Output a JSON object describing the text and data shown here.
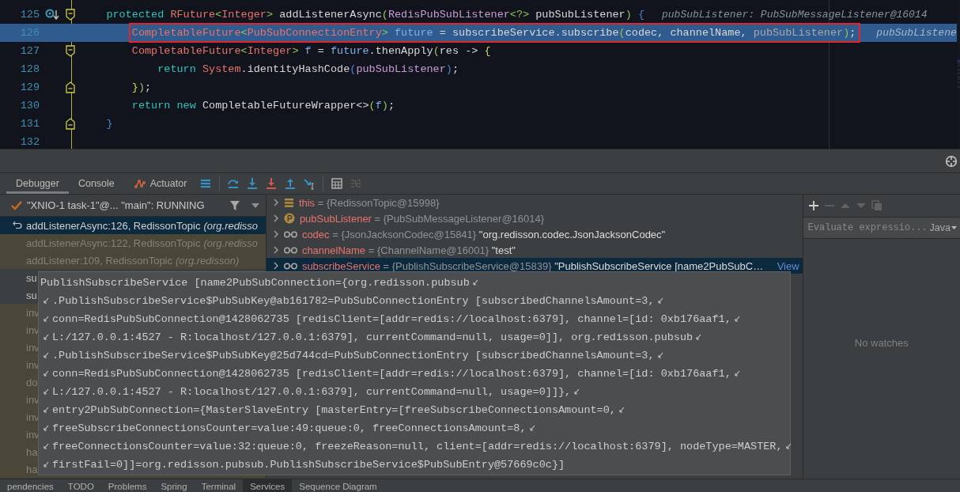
{
  "editor": {
    "lines": [
      {
        "number": "125",
        "method_breakpoint": true,
        "fold_open": true,
        "fold_close": false,
        "selected": false,
        "tokens": [
          {
            "kind": "kw",
            "text": "    protected "
          },
          {
            "kind": "type",
            "text": "RFuture"
          },
          {
            "kind": "angle",
            "text": "<"
          },
          {
            "kind": "type",
            "text": "Integer"
          },
          {
            "kind": "angle",
            "text": ">"
          },
          {
            "kind": "plain",
            "text": " addListenerAsync"
          },
          {
            "kind": "paren",
            "text": "("
          },
          {
            "kind": "iface",
            "text": "RedisPubSubListener"
          },
          {
            "kind": "angle",
            "text": "<?>"
          },
          {
            "kind": "plain",
            "text": " pubSubListener"
          },
          {
            "kind": "paren",
            "text": ")"
          },
          {
            "kind": "brace",
            "text": " {"
          }
        ],
        "hint": "pubSubListener: PubSubMessageListener@16014"
      },
      {
        "number": "126",
        "fold_open": false,
        "fold_close": false,
        "selected": true,
        "boxed": true,
        "tokens": [
          {
            "kind": "type",
            "text": "        CompletableFuture"
          },
          {
            "kind": "angle",
            "text": "<"
          },
          {
            "kind": "type",
            "text": "PubSubConnectionEntry"
          },
          {
            "kind": "angle",
            "text": ">"
          },
          {
            "kind": "local",
            "text": " future"
          },
          {
            "kind": "plain",
            "text": " = subscribeService.subscribe"
          },
          {
            "kind": "paren",
            "text": "("
          },
          {
            "kind": "plain",
            "text": "codec, channelName, "
          },
          {
            "kind": "dim",
            "text": "pubSubListener"
          },
          {
            "kind": "paren",
            "text": ")"
          },
          {
            "kind": "plain",
            "text": ";"
          }
        ],
        "hint": "pubSubListene"
      },
      {
        "number": "127",
        "fold_open": true,
        "fold_close": false,
        "selected": false,
        "tokens": [
          {
            "kind": "type",
            "text": "        CompletableFuture"
          },
          {
            "kind": "angle",
            "text": "<"
          },
          {
            "kind": "type",
            "text": "Integer"
          },
          {
            "kind": "angle",
            "text": ">"
          },
          {
            "kind": "local",
            "text": " f"
          },
          {
            "kind": "plain",
            "text": " = "
          },
          {
            "kind": "local",
            "text": "future"
          },
          {
            "kind": "plain",
            "text": ".thenApply"
          },
          {
            "kind": "paren",
            "text": "("
          },
          {
            "kind": "plain",
            "text": "res -> "
          },
          {
            "kind": "lambda",
            "text": "{"
          }
        ]
      },
      {
        "number": "128",
        "fold_open": false,
        "fold_close": false,
        "selected": false,
        "tokens": [
          {
            "kind": "kw",
            "text": "            return "
          },
          {
            "kind": "type",
            "text": "System"
          },
          {
            "kind": "plain",
            "text": ".identityHashCode"
          },
          {
            "kind": "brace",
            "text": "("
          },
          {
            "kind": "iface",
            "text": "pubSubListener"
          },
          {
            "kind": "brace",
            "text": ")"
          },
          {
            "kind": "plain",
            "text": ";"
          }
        ]
      },
      {
        "number": "129",
        "fold_open": false,
        "fold_close": true,
        "selected": false,
        "tokens": [
          {
            "kind": "lambda",
            "text": "        }"
          },
          {
            "kind": "paren",
            "text": ")"
          },
          {
            "kind": "plain",
            "text": ";"
          }
        ]
      },
      {
        "number": "130",
        "fold_open": false,
        "fold_close": false,
        "selected": false,
        "tokens": [
          {
            "kind": "kw",
            "text": "        return new "
          },
          {
            "kind": "plain",
            "text": "CompletableFutureWrapper<>"
          },
          {
            "kind": "paren",
            "text": "("
          },
          {
            "kind": "local",
            "text": "f"
          },
          {
            "kind": "paren",
            "text": ")"
          },
          {
            "kind": "plain",
            "text": ";"
          }
        ]
      },
      {
        "number": "131",
        "fold_open": false,
        "fold_close": true,
        "selected": false,
        "tokens": [
          {
            "kind": "brace",
            "text": "    }"
          }
        ]
      },
      {
        "number": "132",
        "fold_open": false,
        "fold_close": false,
        "selected": false
      }
    ]
  },
  "debug_tabs": [
    {
      "label": "Debugger",
      "selected": true
    },
    {
      "label": "Console",
      "selected": false
    },
    {
      "label": "Actuator",
      "selected": false
    }
  ],
  "thread": {
    "label": "\"XNIO-1 task-1\"@... \"main\": RUNNING"
  },
  "frames": [
    {
      "location": "addListenerAsync:126, RedissonTopic",
      "package": "(org.redisso",
      "selected": true,
      "library": false
    },
    {
      "location": "addListenerAsync:122, RedissonTopic",
      "package": "(org.redisso",
      "selected": false,
      "library": true
    },
    {
      "location": "addListener:109, RedissonTopic",
      "package": "(org.redisson)",
      "selected": false,
      "library": true
    },
    {
      "location": "su",
      "selected": false,
      "library": false
    },
    {
      "location": "su",
      "selected": false,
      "library": false
    },
    {
      "location": "inv",
      "selected": false,
      "library": true
    },
    {
      "location": "inv",
      "selected": false,
      "library": true
    },
    {
      "location": "inv",
      "selected": false,
      "library": true
    },
    {
      "location": "inv",
      "selected": false,
      "library": true
    },
    {
      "location": "do",
      "selected": false,
      "library": true
    },
    {
      "location": "inv",
      "selected": false,
      "library": true
    },
    {
      "location": "inv",
      "selected": false,
      "library": true
    },
    {
      "location": "inv",
      "selected": false,
      "library": true
    },
    {
      "location": "ha",
      "selected": false,
      "library": true
    },
    {
      "location": "ha",
      "selected": false,
      "library": true
    }
  ],
  "variables": [
    {
      "kind": "field",
      "name": "this",
      "value": "= {RedissonTopic@15998}",
      "selected": false
    },
    {
      "kind": "param",
      "name": "pubSubListener",
      "value": "= {PubSubMessageListener@16014}",
      "selected": false
    },
    {
      "kind": "local",
      "name": "codec",
      "value": "= {JsonJacksonCodec@15841}",
      "string": "\"org.redisson.codec.JsonJacksonCodec\"",
      "selected": false
    },
    {
      "kind": "local",
      "name": "channelName",
      "value": "= {ChannelName@16001}",
      "string": "\"test\"",
      "selected": false
    },
    {
      "kind": "local",
      "name": "subscribeService",
      "value": "= {PublishSubscribeService@15839}",
      "string": "\"PublishSubscribeService [name2PubSubC…",
      "link": "View",
      "selected": true
    }
  ],
  "watches": {
    "placeholder": "Evaluate expressio...",
    "language": "Java",
    "empty_text": "No watches"
  },
  "tooltip": {
    "lines": [
      {
        "text": "PublishSubscribeService [name2PubSubConnection={org.redisson.pubsub",
        "continued": false,
        "wraps": true
      },
      {
        "text": ".PublishSubscribeService$PubSubKey@ab161782=PubSubConnectionEntry [subscribedChannelsAmount=3,",
        "continued": true,
        "wraps": true
      },
      {
        "text": "conn=RedisPubSubConnection@1428062735 [redisClient=[addr=redis://localhost:6379], channel=[id: 0xb176aaf1,",
        "continued": true,
        "wraps": true
      },
      {
        "text": "L:/127.0.0.1:4527 - R:localhost/127.0.0.1:6379], currentCommand=null, usage=0]], org.redisson.pubsub",
        "continued": true,
        "wraps": true
      },
      {
        "text": ".PublishSubscribeService$PubSubKey@25d744cd=PubSubConnectionEntry [subscribedChannelsAmount=3,",
        "continued": true,
        "wraps": true
      },
      {
        "text": "conn=RedisPubSubConnection@1428062735 [redisClient=[addr=redis://localhost:6379], channel=[id: 0xb176aaf1,",
        "continued": true,
        "wraps": true
      },
      {
        "text": "L:/127.0.0.1:4527 - R:localhost/127.0.0.1:6379], currentCommand=null, usage=0]]},",
        "continued": true,
        "wraps": true
      },
      {
        "text": "entry2PubSubConnection={MasterSlaveEntry [masterEntry=[freeSubscribeConnectionsAmount=0,",
        "continued": true,
        "wraps": true
      },
      {
        "text": "freeSubscribeConnectionsCounter=value:49:queue:0, freeConnectionsAmount=8,",
        "continued": true,
        "wraps": true
      },
      {
        "text": "freeConnectionsCounter=value:32:queue:0, freezeReason=null, client=[addr=redis://localhost:6379], nodeType=MASTER,",
        "continued": true,
        "wraps": true
      },
      {
        "text": " firstFail=0]]=org.redisson.pubsub.PublishSubscribeService$PubSubEntry@57669c0c}]",
        "continued": true,
        "wraps": false
      }
    ]
  },
  "bottom_tabs": [
    {
      "label": "pendencies",
      "selected": false
    },
    {
      "label": "TODO",
      "selected": false
    },
    {
      "label": "Problems",
      "selected": false
    },
    {
      "label": "Spring",
      "selected": false
    },
    {
      "label": "Terminal",
      "selected": false
    },
    {
      "label": "Services",
      "selected": true
    },
    {
      "label": "Sequence Diagram",
      "selected": false
    }
  ]
}
